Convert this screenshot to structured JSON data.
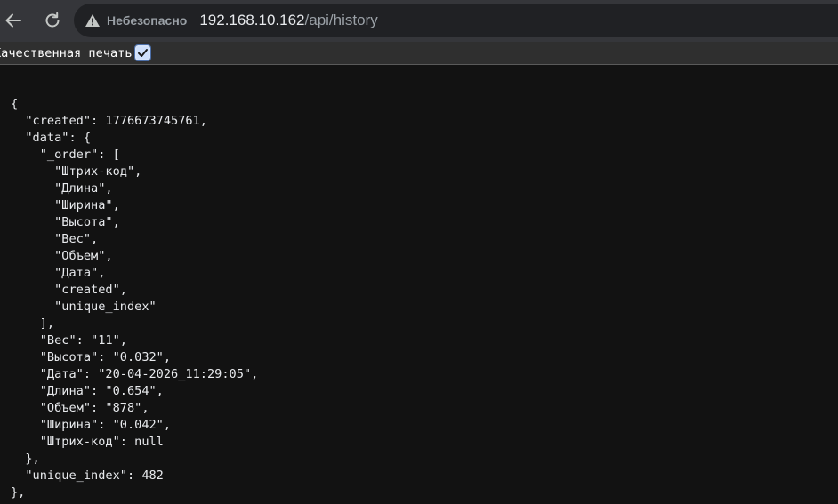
{
  "browser": {
    "security_label": "Небезопасно",
    "url_host": "192.168.10.162",
    "url_path": "/api/history"
  },
  "pretty_print": {
    "label": "Качественная печать",
    "checked": true
  },
  "json_lines": [
    "{",
    "  \"created\": 1776673745761,",
    "  \"data\": {",
    "    \"_order\": [",
    "      \"Штрих-код\",",
    "      \"Длина\",",
    "      \"Ширина\",",
    "      \"Высота\",",
    "      \"Вес\",",
    "      \"Объем\",",
    "      \"Дата\",",
    "      \"created\",",
    "      \"unique_index\"",
    "    ],",
    "    \"Вес\": \"11\",",
    "    \"Высота\": \"0.032\",",
    "    \"Дата\": \"20-04-2026_11:29:05\",",
    "    \"Длина\": \"0.654\",",
    "    \"Объем\": \"878\",",
    "    \"Ширина\": \"0.042\",",
    "    \"Штрих-код\": null",
    "  },",
    "  \"unique_index\": 482",
    "},"
  ]
}
